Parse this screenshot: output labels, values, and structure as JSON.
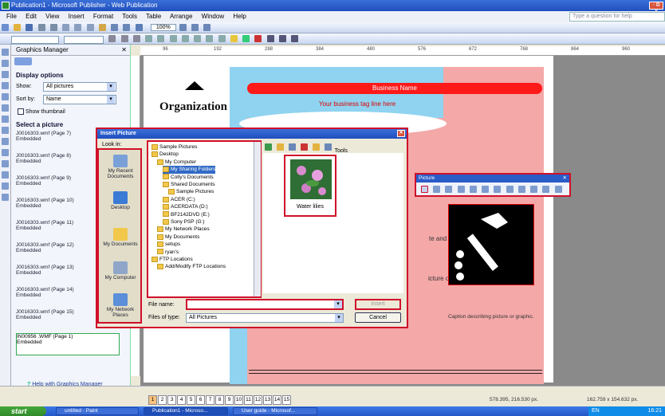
{
  "window": {
    "title": "Publication1 - Microsoft Publisher - Web Publication",
    "controls": "-  ⧉ ✕"
  },
  "menu": {
    "items": [
      "File",
      "Edit",
      "View",
      "Insert",
      "Format",
      "Tools",
      "Table",
      "Arrange",
      "Window",
      "Help"
    ],
    "help_placeholder": "Type a question for help"
  },
  "toolbar": {
    "zoom": "100%"
  },
  "ruler": {
    "ticks": [
      "96",
      "192",
      "288",
      "384",
      "480",
      "576",
      "672",
      "768",
      "864",
      "960"
    ]
  },
  "taskpane": {
    "title": "Graphics Manager",
    "close": "✕",
    "display_options": "Display options",
    "show_label": "Show:",
    "show_value": "All pictures",
    "sort_label": "Sort by:",
    "sort_value": "Name",
    "thumbnail_label": "Show thumbnail",
    "select_label": "Select a picture",
    "clips": [
      {
        "name": "J0016303.wmf (Page 7)",
        "status": "Embedded"
      },
      {
        "name": "J0016303.wmf (Page 8)",
        "status": "Embedded"
      },
      {
        "name": "J0016303.wmf (Page 9)",
        "status": "Embedded"
      },
      {
        "name": "J0016303.wmf (Page 10)",
        "status": "Embedded"
      },
      {
        "name": "J0016303.wmf (Page 11)",
        "status": "Embedded"
      },
      {
        "name": "J0016303.wmf (Page 12)",
        "status": "Embedded"
      },
      {
        "name": "J0016303.wmf (Page 13)",
        "status": "Embedded"
      },
      {
        "name": "J0016303.wmf (Page 14)",
        "status": "Embedded"
      },
      {
        "name": "J0016303.wmf (Page 15)",
        "status": "Embedded"
      }
    ],
    "selected_clip": {
      "name": "IN00956 .WMF (Page 1)",
      "status": "Embedded"
    },
    "help_link": "Help with Graphics Manager"
  },
  "publication": {
    "organization": "Organization",
    "business_name": "Business Name",
    "tagline": "Your business tag line here",
    "body_fragment1": "te and",
    "body_fragment2": "icture of",
    "caption": "Caption describing picture or graphic."
  },
  "picture_toolbar": {
    "title": "Picture",
    "close": "✕"
  },
  "dialog": {
    "title": "Insert Picture",
    "close": "✕",
    "look_in_label": "Look in:",
    "tools_label": "Tools",
    "places": [
      "My Recent Documents",
      "Desktop",
      "My Documents",
      "My Computer",
      "My Network Places"
    ],
    "folders": [
      {
        "label": "Sample Pictures",
        "indent": 0,
        "selected": false
      },
      {
        "label": "Desktop",
        "indent": 0,
        "selected": false
      },
      {
        "label": "My Computer",
        "indent": 1,
        "selected": false
      },
      {
        "label": "My Sharing Folders",
        "indent": 2,
        "selected": true
      },
      {
        "label": "Colly's Documents",
        "indent": 2,
        "selected": false
      },
      {
        "label": "Shared Documents",
        "indent": 2,
        "selected": false
      },
      {
        "label": "Sample Pictures",
        "indent": 3,
        "selected": false
      },
      {
        "label": "ACER (C:)",
        "indent": 2,
        "selected": false
      },
      {
        "label": "ACERDATA (D:)",
        "indent": 2,
        "selected": false
      },
      {
        "label": "BF2142DVD (E:)",
        "indent": 2,
        "selected": false
      },
      {
        "label": "Sony PSP (G:)",
        "indent": 2,
        "selected": false
      },
      {
        "label": "My Network Places",
        "indent": 1,
        "selected": false
      },
      {
        "label": "My Documents",
        "indent": 1,
        "selected": false
      },
      {
        "label": "setups",
        "indent": 1,
        "selected": false
      },
      {
        "label": "ryan's",
        "indent": 1,
        "selected": false
      },
      {
        "label": "FTP Locations",
        "indent": 0,
        "selected": false
      },
      {
        "label": "Add/Modify FTP Locations",
        "indent": 1,
        "selected": false
      }
    ],
    "file_item": "Water lilies",
    "file_name_label": "File name:",
    "file_name_value": "",
    "file_type_label": "Files of type:",
    "file_type_value": "All Pictures",
    "insert_label": "Insert",
    "cancel_label": "Cancel"
  },
  "status": {
    "pages": [
      "1",
      "2",
      "3",
      "4",
      "5",
      "6",
      "7",
      "8",
      "9",
      "10",
      "11",
      "12",
      "13",
      "14",
      "15"
    ],
    "current_page": "1",
    "position": "578.395, 216.530 px.",
    "size": "162.759 x 154.632 px."
  },
  "taskbar": {
    "start": "start",
    "tasks": [
      "untitled - Paint",
      "Publication1 - Microso...",
      "User guide - Microsof..."
    ],
    "tray_lang": "EN",
    "clock": "16:21"
  }
}
